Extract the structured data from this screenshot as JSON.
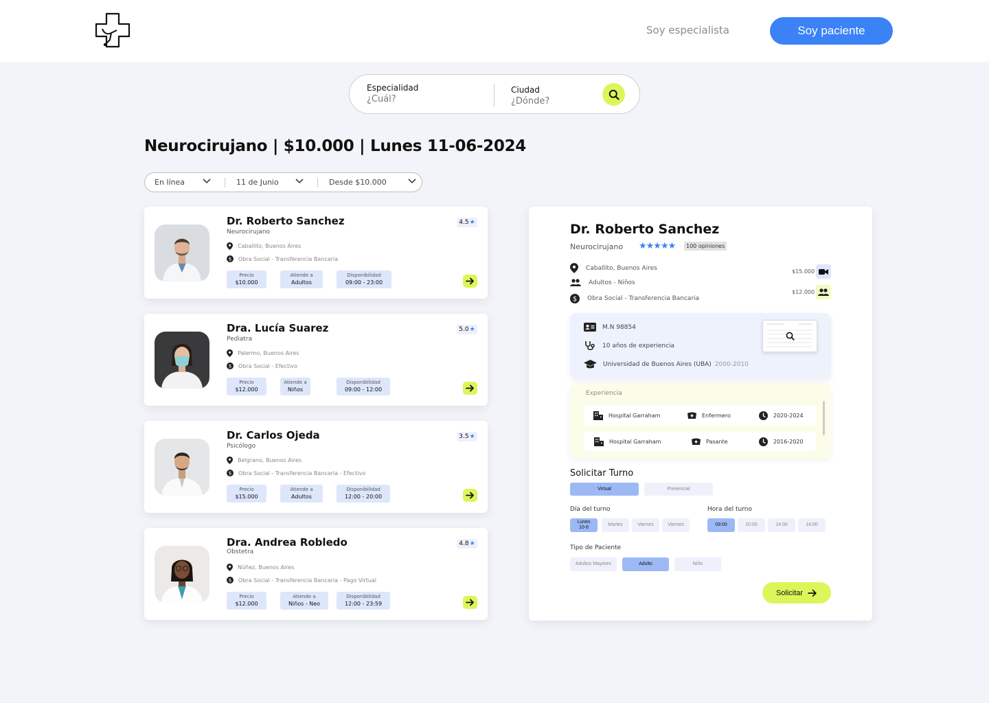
{
  "header": {
    "specialist_label": "Soy especialista",
    "patient_label": "Soy paciente"
  },
  "search": {
    "specialty_label": "Especialidad",
    "specialty_placeholder": "¿Cuál?",
    "city_label": "Ciudad",
    "city_placeholder": "¿Dónde?"
  },
  "headline": "Neurocirujano | $10.000 | Lunes 11-06-2024",
  "filters": [
    "En línea",
    "11 de Junio",
    "Desde $10.000"
  ],
  "doctors": [
    {
      "name": "Dr. Roberto Sanchez",
      "specialty": "Neurocirujano",
      "rating": "4.5",
      "location": "Caballito, Buenos Aires",
      "payment": "Obra Social - Transferencia Bancaria",
      "price_label": "Precio",
      "price": "$10.000",
      "attends_label": "Atiende a",
      "attends": "Adultos",
      "availability_label": "Disponibilidad",
      "availability": "09:00 - 23:00"
    },
    {
      "name": "Dra. Lucía Suarez",
      "specialty": "Pediatra",
      "rating": "5.0",
      "location": "Palermo, Buenos Aires",
      "payment": "Obra Social - Efectivo",
      "price_label": "Precio",
      "price": "$12.000",
      "attends_label": "Atiende a",
      "attends": "Niños",
      "availability_label": "Disponibilidad",
      "availability": "09:00 - 12:00"
    },
    {
      "name": "Dr. Carlos Ojeda",
      "specialty": "Psicólogo",
      "rating": "3.5",
      "location": "Belgrano, Buenos Aires",
      "payment": "Obra Social - Transferencia Bancaria - Efectivo",
      "price_label": "Precio",
      "price": "$15.000",
      "attends_label": "Atiende a",
      "attends": "Adultos",
      "availability_label": "Disponibilidad",
      "availability": "12:00 - 20:00"
    },
    {
      "name": "Dra. Andrea Robledo",
      "specialty": "Obstetra",
      "rating": "4.8",
      "location": "Núñez, Buenos Aires",
      "payment": "Obra Social - Transferencia Bancaria - Pago Virtual",
      "price_label": "Precio",
      "price": "$12.000",
      "attends_label": "Atiende a",
      "attends": "Niños - Neo",
      "availability_label": "Disponibilidad",
      "availability": "12:00 - 23:59"
    }
  ],
  "detail": {
    "name": "Dr. Roberto Sanchez",
    "specialty": "Neurocirujano",
    "stars": "★★★★★",
    "reviews": "100 opiniones",
    "location": "Caballito, Buenos Aires",
    "attends": "Adultos - Niños",
    "payment": "Obra Social - Transferencia Bancaria",
    "price_virtual": "$15.000",
    "price_presencial": "$12.000",
    "license": "M.N 98854",
    "experience_years": "10 años de experiencia",
    "university": "Universidad de Buenos Aires (UBA)",
    "university_years": "2000-2010",
    "experience_title": "Experiencia",
    "experience": [
      {
        "place": "Hospital Garraham",
        "role": "Enfermero",
        "period": "2020-2024"
      },
      {
        "place": "Hospital Garraham",
        "role": "Pasante",
        "period": "2016-2020"
      }
    ],
    "booking_title": "Solicitar Turno",
    "mode_options": [
      "Virtual",
      "Presencial"
    ],
    "day_label": "Día del turno",
    "days": [
      "Lunes 10-6",
      "Martes",
      "Viernes",
      "Viernes"
    ],
    "hour_label": "Hora del turno",
    "hours": [
      "09:00",
      "10:00",
      "14:00",
      "14:00"
    ],
    "patient_type_label": "Tipo de Paciente",
    "patient_types": [
      "Adultos Mayores",
      "Adulto",
      "Niño"
    ],
    "submit_label": "Solicitar"
  },
  "colors": {
    "primary_blue": "#3b82f6",
    "accent_lime": "#dcf65a",
    "background": "#f3f4f9",
    "chip_blue": "#dde6fb",
    "selected_blue": "#9db9f5"
  }
}
